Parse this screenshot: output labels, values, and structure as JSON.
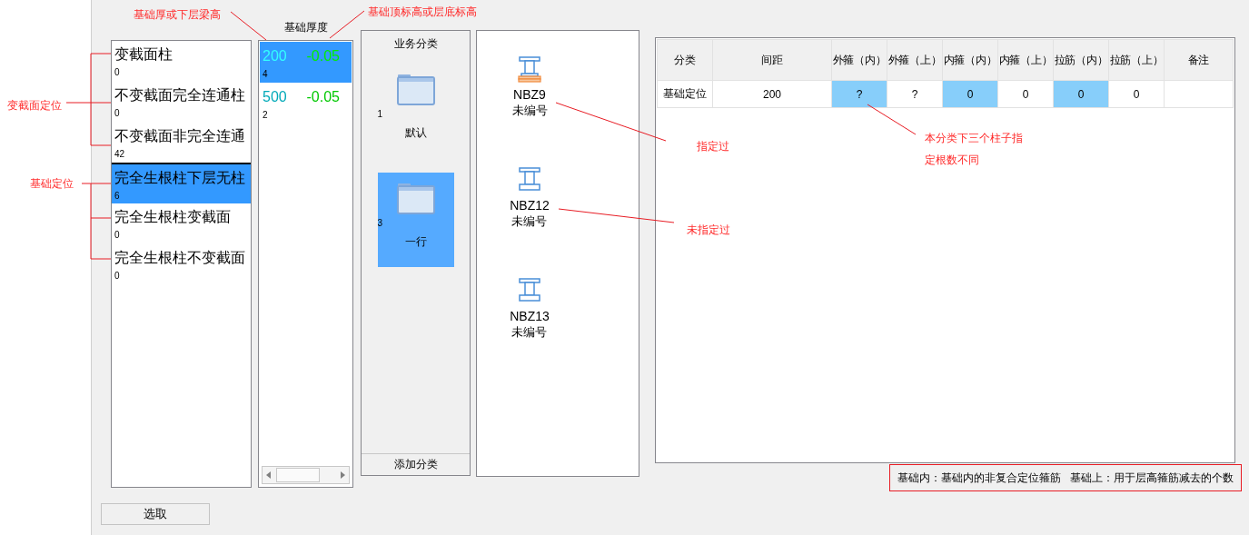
{
  "annotations": [
    {
      "text": "基础厚或下层梁高"
    },
    {
      "text": "基础顶标高或层底标高"
    },
    {
      "text": "变截面定位"
    },
    {
      "text": "基础定位"
    },
    {
      "text": "指定过"
    },
    {
      "text": "未指定过"
    },
    {
      "text": "本分类下三个柱子指"
    },
    {
      "text": "定根数不同"
    }
  ],
  "position_list": {
    "items": [
      {
        "label": "变截面柱",
        "count": "0",
        "selected": false
      },
      {
        "label": "不变截面完全连通柱",
        "count": "0",
        "selected": false
      },
      {
        "label": "不变截面非完全连通",
        "count": "42",
        "selected": false
      },
      {
        "label": "完全生根柱下层无柱",
        "count": "6",
        "selected": true
      },
      {
        "label": "完全生根柱变截面",
        "count": "0",
        "selected": false
      },
      {
        "label": "完全生根柱不变截面",
        "count": "0",
        "selected": false
      }
    ]
  },
  "thickness_list": {
    "header": "基础厚度",
    "items": [
      {
        "thickness": "200",
        "elevation": "-0.05",
        "count": "4",
        "selected": true
      },
      {
        "thickness": "500",
        "elevation": "-0.05",
        "count": "2",
        "selected": false
      }
    ]
  },
  "categories": {
    "header": "业务分类",
    "items": [
      {
        "count": "1",
        "label": "默认",
        "selected": false
      },
      {
        "count": "3",
        "label": "一行",
        "selected": true
      }
    ],
    "add_button": "添加分类"
  },
  "columns": [
    {
      "name": "NBZ9",
      "number": "未编号",
      "assigned": true
    },
    {
      "name": "NBZ12",
      "number": "未编号",
      "assigned": false
    },
    {
      "name": "NBZ13",
      "number": "未编号",
      "assigned": false
    }
  ],
  "table": {
    "columns": [
      "分类",
      "间距",
      "外箍（内）",
      "外箍（上）",
      "内箍（内）",
      "内箍（上）",
      "拉筋（内）",
      "拉筋（上）",
      "备注"
    ],
    "rows": [
      {
        "cells": [
          {
            "text": "基础定位",
            "highlighted": false
          },
          {
            "text": "200",
            "highlighted": false
          },
          {
            "text": "?",
            "highlighted": true
          },
          {
            "text": "?",
            "highlighted": false
          },
          {
            "text": "0",
            "highlighted": true
          },
          {
            "text": "0",
            "highlighted": false
          },
          {
            "text": "0",
            "highlighted": true
          },
          {
            "text": "0",
            "highlighted": false
          },
          {
            "text": "",
            "highlighted": false
          }
        ]
      }
    ]
  },
  "note": "基础内：基础内的非复合定位箍筋   基础上：用于层高箍筋减去的个数",
  "select_button": "选取"
}
